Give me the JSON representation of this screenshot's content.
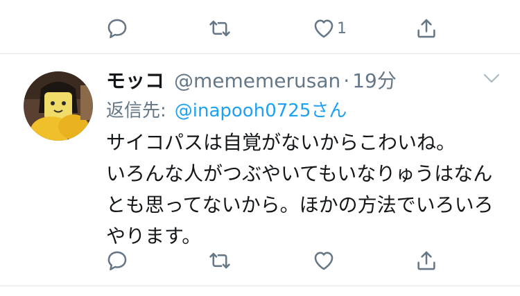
{
  "top_actions": {
    "reply_icon": "reply-icon",
    "retweet_icon": "retweet-icon",
    "like_icon": "heart-icon",
    "like_count": "1",
    "share_icon": "share-icon"
  },
  "tweet": {
    "author_name": "モッコ",
    "handle": "@mememerusan",
    "separator": "·",
    "time": "19分",
    "reply_label": "返信先:",
    "reply_target": "@inapooh0725さん",
    "text_lines": [
      "サイコパスは自覚がないからこわいね。",
      "いろんな人がつぶやいてもいなりゅうはなん",
      "とも思ってないから。ほかの方法でいろいろ",
      "やります。"
    ],
    "actions": {
      "reply_icon": "reply-icon",
      "retweet_icon": "retweet-icon",
      "like_icon": "heart-icon",
      "share_icon": "share-icon"
    }
  },
  "colors": {
    "icon_gray": "#657786",
    "link_blue": "#1da1f2",
    "divider": "#e1e8ed"
  }
}
